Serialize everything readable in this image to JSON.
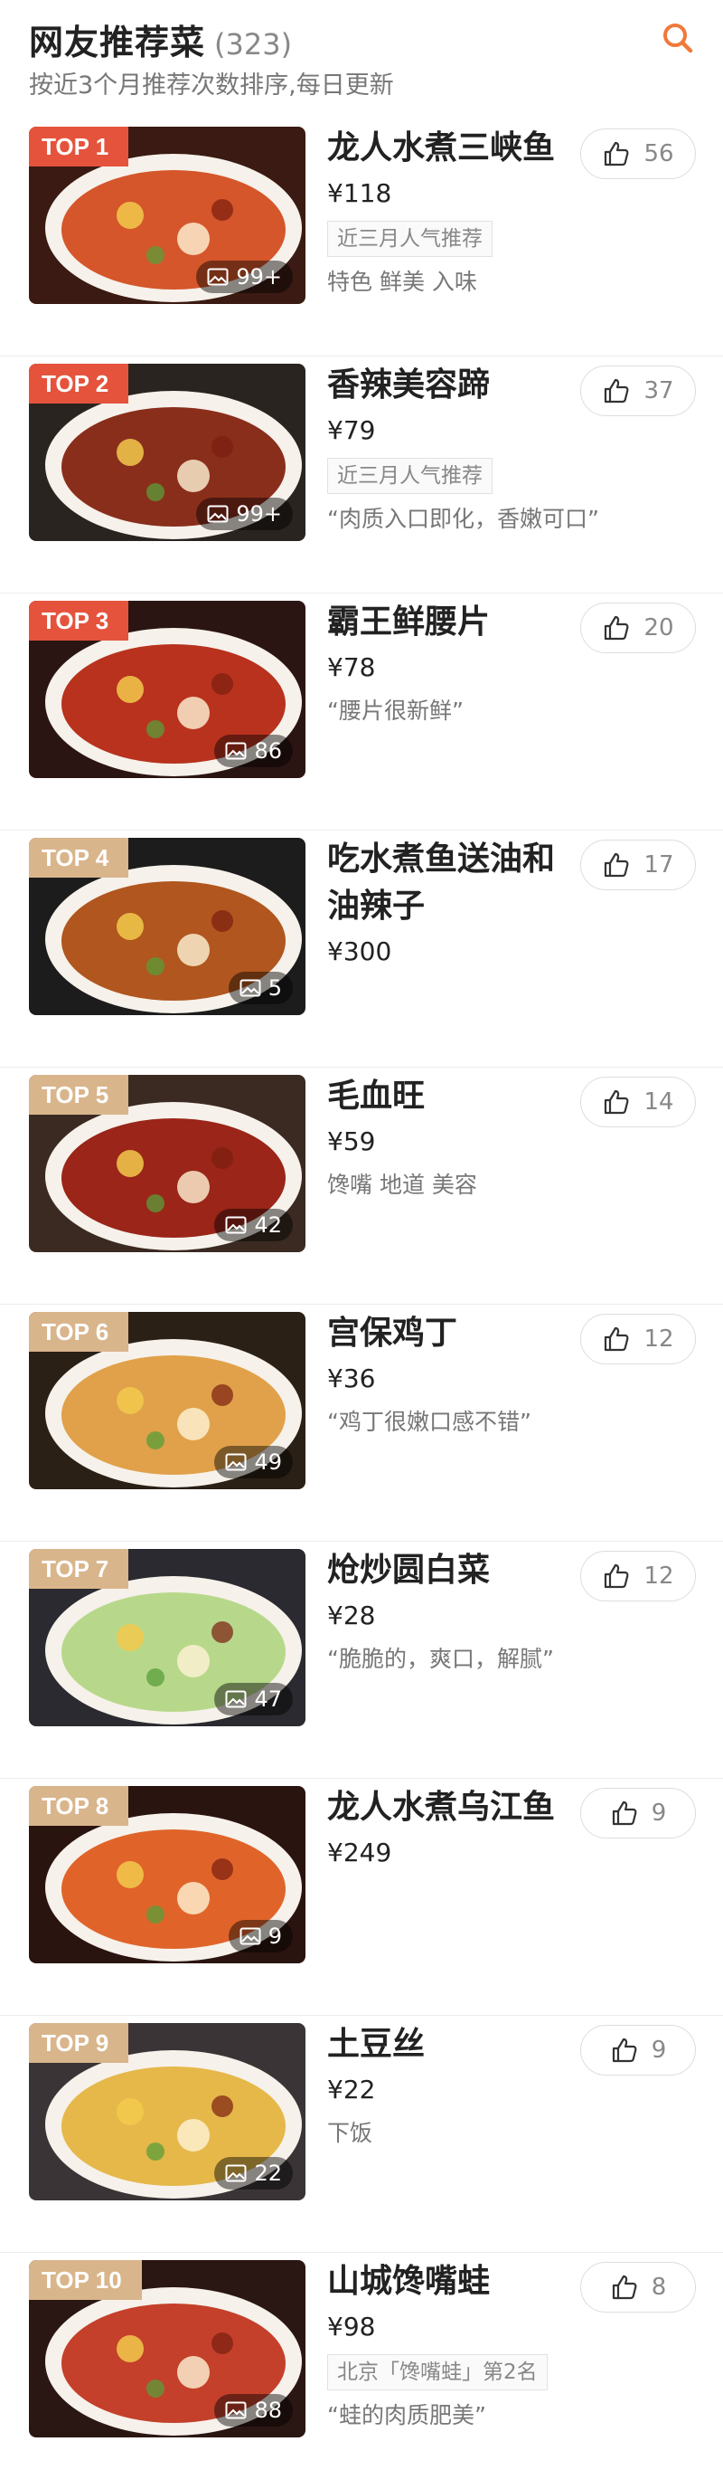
{
  "header": {
    "title": "网友推荐菜",
    "count": "(323)",
    "subtitle": "按近3个月推荐次数排序,每日更新"
  },
  "colors": {
    "accent": "#f0793a",
    "top3_badge": "#e5533c",
    "other_badge": "#d9b58c"
  },
  "items": [
    {
      "rank": "TOP 1",
      "name": "龙人水煮三峡鱼",
      "price": "¥118",
      "tag": "近三月人气推荐",
      "note": "特色 鲜美 入味",
      "likes": "56",
      "photos": "99+"
    },
    {
      "rank": "TOP 2",
      "name": "香辣美容蹄",
      "price": "¥79",
      "tag": "近三月人气推荐",
      "note": "“肉质入口即化，香嫩可口”",
      "likes": "37",
      "photos": "99+"
    },
    {
      "rank": "TOP 3",
      "name": "霸王鲜腰片",
      "price": "¥78",
      "tag": "",
      "note": "“腰片很新鲜”",
      "likes": "20",
      "photos": "86"
    },
    {
      "rank": "TOP 4",
      "name": "吃水煮鱼送油和油辣子",
      "price": "¥300",
      "tag": "",
      "note": "",
      "likes": "17",
      "photos": "5"
    },
    {
      "rank": "TOP 5",
      "name": "毛血旺",
      "price": "¥59",
      "tag": "",
      "note": "馋嘴 地道 美容",
      "likes": "14",
      "photos": "42"
    },
    {
      "rank": "TOP 6",
      "name": "宫保鸡丁",
      "price": "¥36",
      "tag": "",
      "note": "“鸡丁很嫩口感不错”",
      "likes": "12",
      "photos": "49"
    },
    {
      "rank": "TOP 7",
      "name": "炝炒圆白菜",
      "price": "¥28",
      "tag": "",
      "note": "“脆脆的，爽口，解腻”",
      "likes": "12",
      "photos": "47"
    },
    {
      "rank": "TOP 8",
      "name": "龙人水煮乌江鱼",
      "price": "¥249",
      "tag": "",
      "note": "",
      "likes": "9",
      "photos": "9"
    },
    {
      "rank": "TOP 9",
      "name": "土豆丝",
      "price": "¥22",
      "tag": "",
      "note": "下饭",
      "likes": "9",
      "photos": "22"
    },
    {
      "rank": "TOP 10",
      "name": "山城馋嘴蛙",
      "price": "¥98",
      "tag": "北京「馋嘴蛙」第2名",
      "note": "“蛙的肉质肥美”",
      "likes": "8",
      "photos": "88"
    }
  ]
}
